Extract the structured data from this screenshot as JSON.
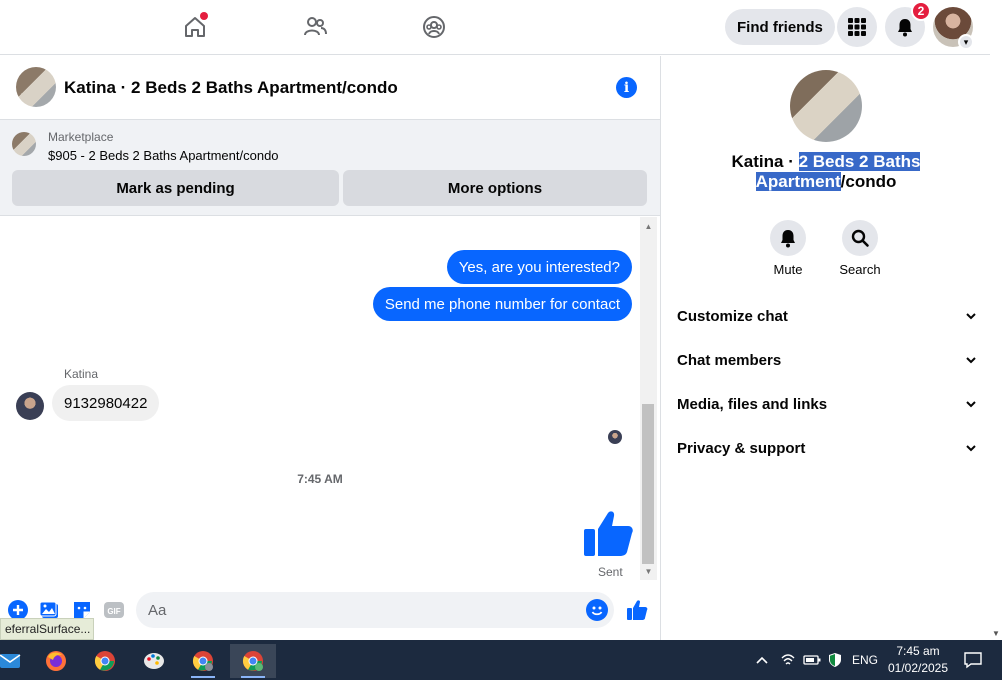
{
  "topbar": {
    "find_friends_label": "Find friends",
    "notifications_count": "2"
  },
  "chat_header": {
    "title": "Katina · 2 Beds 2 Baths Apartment/condo",
    "info_glyph": "i"
  },
  "marketplace": {
    "label": "Marketplace",
    "listing": "$905 - 2 Beds 2 Baths Apartment/condo",
    "mark_pending_label": "Mark as pending",
    "more_options_label": "More options"
  },
  "messages": {
    "outgoing": [
      {
        "text": "Yes, are you interested?"
      },
      {
        "text": "Send me phone number for contact"
      }
    ],
    "incoming_sender": "Katina",
    "incoming_text": "9132980422",
    "timestamp": "7:45 AM",
    "sent_label": "Sent"
  },
  "composer": {
    "placeholder": "Aa",
    "gif_label": "GIF"
  },
  "tooltip": "eferralSurface...",
  "right_panel": {
    "title_part1": "Katina · ",
    "title_highlight": "2 Beds 2 Baths Apartment",
    "title_part2": "/condo",
    "mute_label": "Mute",
    "search_label": "Search",
    "sections": [
      {
        "label": "Customize chat"
      },
      {
        "label": "Chat members"
      },
      {
        "label": "Media, files and links"
      },
      {
        "label": "Privacy & support"
      }
    ]
  },
  "taskbar": {
    "language": "ENG",
    "time": "7:45 am",
    "date": "01/02/2025"
  },
  "colors": {
    "accent": "#0866ff",
    "badge": "#e41e3f",
    "taskbar": "#1c2a3f",
    "highlight": "#3869c8"
  }
}
